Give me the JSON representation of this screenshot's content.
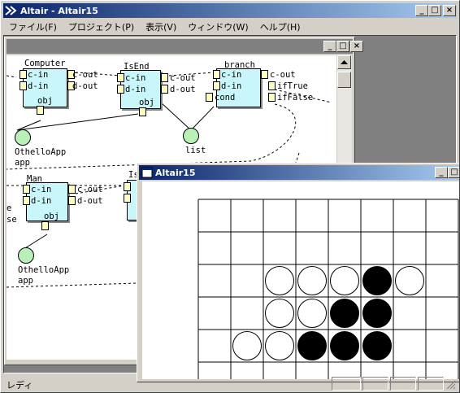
{
  "window": {
    "title": "Altair - Altair15",
    "min": "_",
    "max": "□",
    "close": "×"
  },
  "menu": [
    "ファイル(F)",
    "プロジェクト(P)",
    "表示(V)",
    "ウィンドウ(W)",
    "ヘルプ(H)"
  ],
  "diagram": {
    "nodes": [
      {
        "title": "Computer",
        "inputs": [
          "c-in",
          "d-in"
        ],
        "outputs": [
          "c-out",
          "d-out"
        ],
        "obj": "obj"
      },
      {
        "title": "IsEnd",
        "inputs": [
          "c-in",
          "d-in"
        ],
        "outputs": [
          "c-out",
          "d-out"
        ],
        "obj": "obj"
      },
      {
        "title": "branch",
        "inputs": [
          "c-in",
          "d-in",
          "cond"
        ],
        "outputs": [
          "c-out",
          "ifTrue",
          "ifFalse"
        ]
      },
      {
        "title": "Man",
        "inputs": [
          "c-in",
          "d-in"
        ],
        "outputs": [
          "c-out",
          "d-out"
        ],
        "obj": "obj"
      },
      {
        "title": "Is",
        "inputs": [
          "c-",
          "d-"
        ],
        "outputs": []
      }
    ],
    "circles": [
      {
        "label": "OthelloApp",
        "sub": "app"
      },
      {
        "label": "list",
        "sub": ""
      },
      {
        "label": "OthelloApp",
        "sub": "app"
      }
    ],
    "edge_labels": [
      "e",
      "se"
    ]
  },
  "board_window": {
    "title": "Altair15",
    "cells": [
      [
        "",
        "",
        "",
        "",
        "",
        "",
        "",
        ""
      ],
      [
        "",
        "",
        "",
        "",
        "",
        "",
        "",
        ""
      ],
      [
        "",
        "",
        "W",
        "W",
        "W",
        "B",
        "W",
        ""
      ],
      [
        "",
        "",
        "W",
        "W",
        "B",
        "B",
        "",
        ""
      ],
      [
        "",
        "W",
        "W",
        "B",
        "B",
        "B",
        "",
        ""
      ],
      [
        "",
        "",
        "",
        "",
        "",
        "",
        "",
        ""
      ]
    ]
  },
  "status": {
    "text": "レディ"
  }
}
